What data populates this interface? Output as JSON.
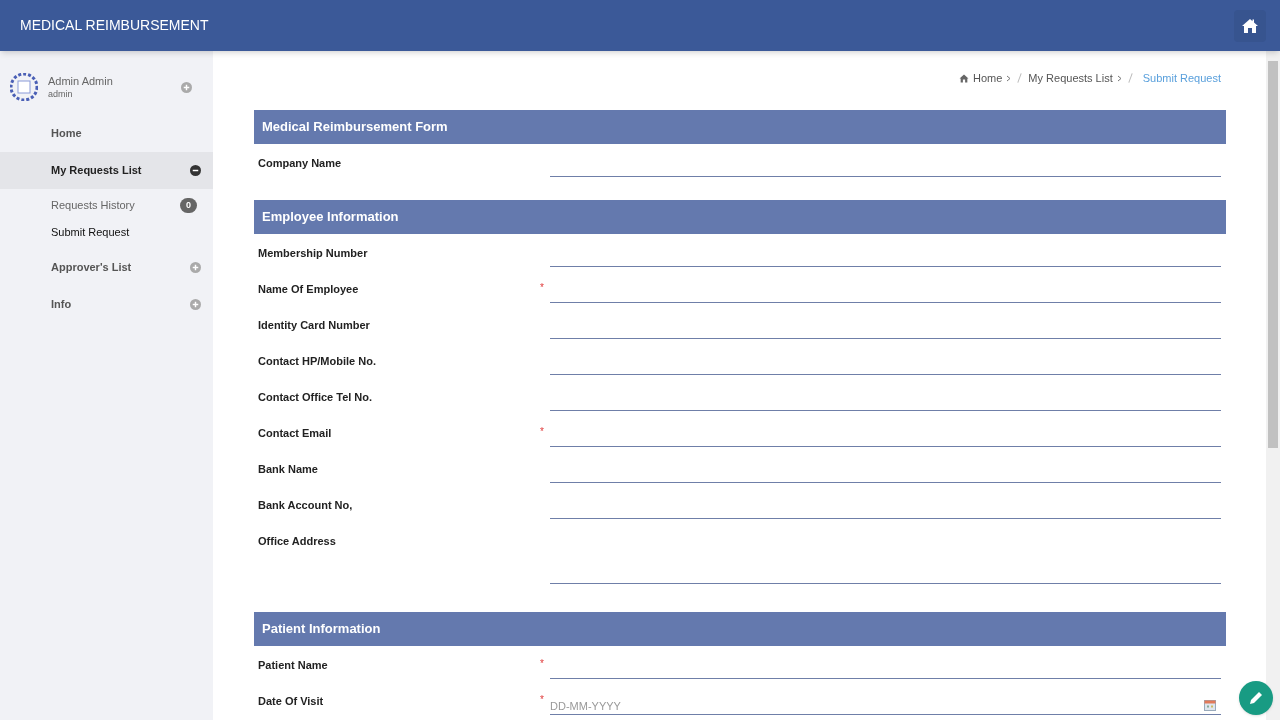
{
  "app_title": "MEDICAL REIMBURSEMENT",
  "sidebar": {
    "user": {
      "name": "Admin Admin",
      "role": "admin"
    },
    "items": [
      {
        "label": "Home",
        "kind": "link",
        "selected": false
      },
      {
        "label": "My Requests List",
        "kind": "group",
        "selected": true,
        "expanded": true,
        "children": [
          {
            "label": "Requests History",
            "badge": "0",
            "selected": false
          },
          {
            "label": "Submit Request",
            "selected": true
          }
        ]
      },
      {
        "label": "Approver's List",
        "kind": "group",
        "selected": false,
        "expanded": false
      },
      {
        "label": "Info",
        "kind": "group",
        "selected": false,
        "expanded": false
      }
    ]
  },
  "breadcrumb": [
    {
      "label": "Home",
      "current": false
    },
    {
      "label": "My Requests List",
      "current": false
    },
    {
      "label": "Submit Request",
      "current": true
    }
  ],
  "sections": [
    {
      "title": "Medical Reimbursement Form",
      "fields": [
        {
          "label": "Company Name",
          "kind": "text"
        }
      ]
    },
    {
      "title": "Employee Information",
      "fields": [
        {
          "label": "Membership Number",
          "kind": "text"
        },
        {
          "label": "Name Of Employee",
          "kind": "text",
          "required_mark": "*"
        },
        {
          "label": "Identity Card Number",
          "kind": "text"
        },
        {
          "label": "Contact HP/Mobile No.",
          "kind": "text"
        },
        {
          "label": "Contact Office Tel No.",
          "kind": "text"
        },
        {
          "label": "Contact Email",
          "kind": "text",
          "required_mark": "*"
        },
        {
          "label": "Bank Name",
          "kind": "text"
        },
        {
          "label": "Bank Account No,",
          "kind": "text"
        },
        {
          "label": "Office Address",
          "kind": "textarea"
        }
      ]
    },
    {
      "title": "Patient Information",
      "fields": [
        {
          "label": "Patient Name",
          "kind": "text",
          "required_mark": "*"
        },
        {
          "label": "Date Of Visit",
          "kind": "date",
          "required_mark": "*",
          "placeholder": "DD-MM-YYYY"
        }
      ]
    }
  ]
}
